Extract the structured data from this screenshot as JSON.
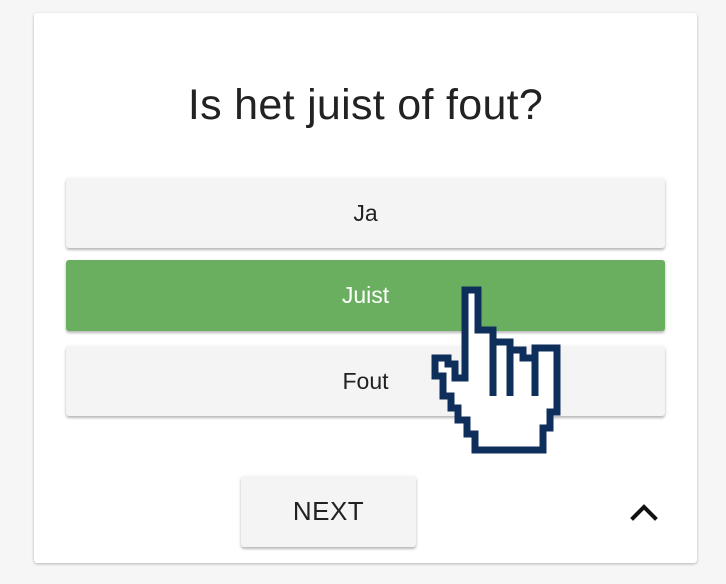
{
  "quiz": {
    "question": "Is het juist of fout?",
    "options": [
      {
        "label": "Ja",
        "selected": false
      },
      {
        "label": "Juist",
        "selected": true
      },
      {
        "label": "Fout",
        "selected": false
      }
    ],
    "next_label": "NEXT"
  },
  "colors": {
    "selected": "#69af5f",
    "option_bg": "#f4f4f4",
    "cursor_outline": "#0e2f5c"
  },
  "icons": {
    "collapse": "chevron-up-icon",
    "cursor": "hand-pointer-cursor"
  }
}
